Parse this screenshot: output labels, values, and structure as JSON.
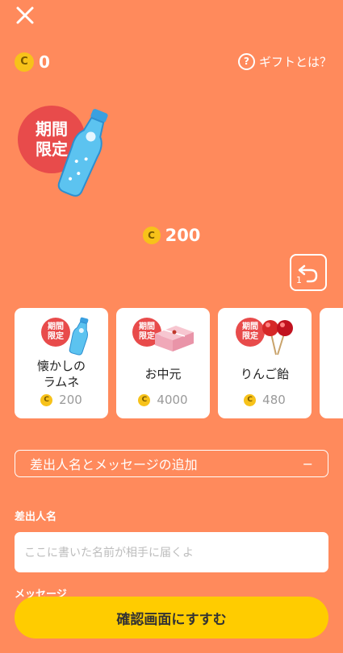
{
  "header": {
    "close_icon": "close-icon",
    "coin_symbol": "C",
    "balance": "0",
    "help_label": "ギフトとは？",
    "help_icon": "question-circle-icon"
  },
  "hero": {
    "badge_line1": "期間",
    "badge_line2": "限定",
    "price": "200"
  },
  "gifts": [
    {
      "badge1": "期間",
      "badge2": "限定",
      "name1": "懐かしの",
      "name2": "ラムネ",
      "price": "200",
      "icon": "ramune-bottle-icon"
    },
    {
      "badge1": "期間",
      "badge2": "限定",
      "name1": "お中元",
      "name2": "",
      "price": "4000",
      "icon": "gift-box-icon"
    },
    {
      "badge1": "期間",
      "badge2": "限定",
      "name1": "りんご飴",
      "name2": "",
      "price": "480",
      "icon": "candy-apple-icon"
    }
  ],
  "message_section": {
    "toggle_label": "差出人名とメッセージの追加",
    "toggle_symbol": "−",
    "sender_label": "差出人名",
    "sender_placeholder": "ここに書いた名前が相手に届くよ",
    "message_label": "メッセージ"
  },
  "confirm_button": "確認画面にすすむ",
  "undo_count": "1",
  "colors": {
    "background": "#FF8A5C",
    "badge": "#E84B4B",
    "coin": "#F7C21A",
    "button": "#FFCC00"
  }
}
